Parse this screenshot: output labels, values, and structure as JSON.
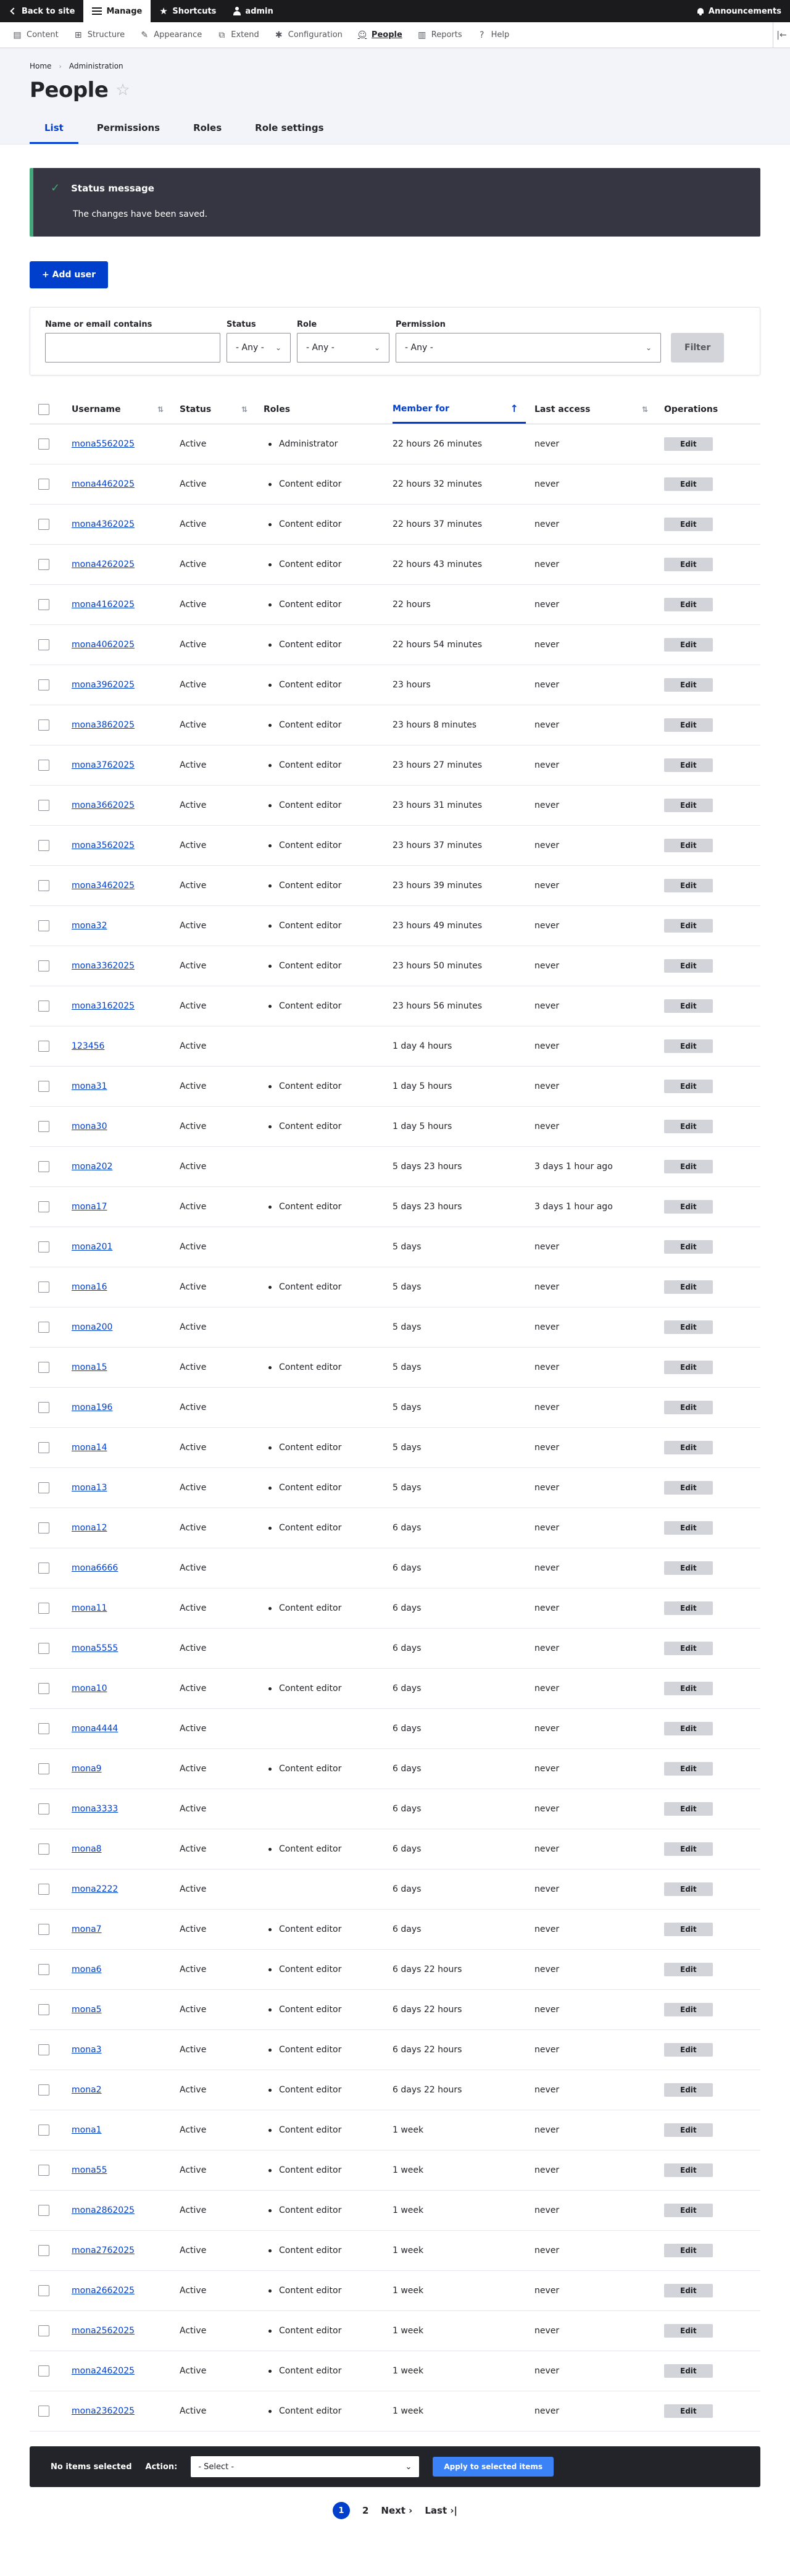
{
  "toolbar": {
    "back": "Back to site",
    "manage": "Manage",
    "shortcuts": "Shortcuts",
    "user": "admin",
    "announcements": "Announcements"
  },
  "admin_menu": [
    {
      "label": "Content",
      "icon": "content-icon"
    },
    {
      "label": "Structure",
      "icon": "structure-icon"
    },
    {
      "label": "Appearance",
      "icon": "appearance-icon"
    },
    {
      "label": "Extend",
      "icon": "extend-icon"
    },
    {
      "label": "Configuration",
      "icon": "configuration-icon"
    },
    {
      "label": "People",
      "icon": "people-icon"
    },
    {
      "label": "Reports",
      "icon": "reports-icon"
    },
    {
      "label": "Help",
      "icon": "help-icon"
    }
  ],
  "breadcrumb": [
    "Home",
    "Administration"
  ],
  "page_title": "People",
  "tabs": [
    "List",
    "Permissions",
    "Roles",
    "Role settings"
  ],
  "status": {
    "title": "Status message",
    "text": "The changes have been saved."
  },
  "add_user": "+ Add user",
  "filter": {
    "name_label": "Name or email contains",
    "status_label": "Status",
    "status_value": "- Any -",
    "role_label": "Role",
    "role_value": "- Any -",
    "permission_label": "Permission",
    "permission_value": "- Any -",
    "button": "Filter"
  },
  "table": {
    "headers": [
      "Username",
      "Status",
      "Roles",
      "Member for",
      "Last access",
      "Operations"
    ],
    "edit_label": "Edit",
    "rows": [
      {
        "username": "mona5562025",
        "status": "Active",
        "role": "Administrator",
        "member_for": "22 hours 26 minutes",
        "last_access": "never"
      },
      {
        "username": "mona4462025",
        "status": "Active",
        "role": "Content editor",
        "member_for": "22 hours 32 minutes",
        "last_access": "never"
      },
      {
        "username": "mona4362025",
        "status": "Active",
        "role": "Content editor",
        "member_for": "22 hours 37 minutes",
        "last_access": "never"
      },
      {
        "username": "mona4262025",
        "status": "Active",
        "role": "Content editor",
        "member_for": "22 hours 43 minutes",
        "last_access": "never"
      },
      {
        "username": "mona4162025",
        "status": "Active",
        "role": "Content editor",
        "member_for": "22 hours",
        "last_access": "never"
      },
      {
        "username": "mona4062025",
        "status": "Active",
        "role": "Content editor",
        "member_for": "22 hours 54 minutes",
        "last_access": "never"
      },
      {
        "username": "mona3962025",
        "status": "Active",
        "role": "Content editor",
        "member_for": "23 hours",
        "last_access": "never"
      },
      {
        "username": "mona3862025",
        "status": "Active",
        "role": "Content editor",
        "member_for": "23 hours 8 minutes",
        "last_access": "never"
      },
      {
        "username": "mona3762025",
        "status": "Active",
        "role": "Content editor",
        "member_for": "23 hours 27 minutes",
        "last_access": "never"
      },
      {
        "username": "mona3662025",
        "status": "Active",
        "role": "Content editor",
        "member_for": "23 hours 31 minutes",
        "last_access": "never"
      },
      {
        "username": "mona3562025",
        "status": "Active",
        "role": "Content editor",
        "member_for": "23 hours 37 minutes",
        "last_access": "never"
      },
      {
        "username": "mona3462025",
        "status": "Active",
        "role": "Content editor",
        "member_for": "23 hours 39 minutes",
        "last_access": "never"
      },
      {
        "username": "mona32",
        "status": "Active",
        "role": "Content editor",
        "member_for": "23 hours 49 minutes",
        "last_access": "never"
      },
      {
        "username": "mona3362025",
        "status": "Active",
        "role": "Content editor",
        "member_for": "23 hours 50 minutes",
        "last_access": "never"
      },
      {
        "username": "mona3162025",
        "status": "Active",
        "role": "Content editor",
        "member_for": "23 hours 56 minutes",
        "last_access": "never"
      },
      {
        "username": "123456",
        "status": "Active",
        "role": "",
        "member_for": "1 day 4 hours",
        "last_access": "never"
      },
      {
        "username": "mona31",
        "status": "Active",
        "role": "Content editor",
        "member_for": "1 day 5 hours",
        "last_access": "never"
      },
      {
        "username": "mona30",
        "status": "Active",
        "role": "Content editor",
        "member_for": "1 day 5 hours",
        "last_access": "never"
      },
      {
        "username": "mona202",
        "status": "Active",
        "role": "",
        "member_for": "5 days 23 hours",
        "last_access": "3 days 1 hour ago"
      },
      {
        "username": "mona17",
        "status": "Active",
        "role": "Content editor",
        "member_for": "5 days 23 hours",
        "last_access": "3 days 1 hour ago"
      },
      {
        "username": "mona201",
        "status": "Active",
        "role": "",
        "member_for": "5 days",
        "last_access": "never"
      },
      {
        "username": "mona16",
        "status": "Active",
        "role": "Content editor",
        "member_for": "5 days",
        "last_access": "never"
      },
      {
        "username": "mona200",
        "status": "Active",
        "role": "",
        "member_for": "5 days",
        "last_access": "never"
      },
      {
        "username": "mona15",
        "status": "Active",
        "role": "Content editor",
        "member_for": "5 days",
        "last_access": "never"
      },
      {
        "username": "mona196",
        "status": "Active",
        "role": "",
        "member_for": "5 days",
        "last_access": "never"
      },
      {
        "username": "mona14",
        "status": "Active",
        "role": "Content editor",
        "member_for": "5 days",
        "last_access": "never"
      },
      {
        "username": "mona13",
        "status": "Active",
        "role": "Content editor",
        "member_for": "5 days",
        "last_access": "never"
      },
      {
        "username": "mona12",
        "status": "Active",
        "role": "Content editor",
        "member_for": "6 days",
        "last_access": "never"
      },
      {
        "username": "mona6666",
        "status": "Active",
        "role": "",
        "member_for": "6 days",
        "last_access": "never"
      },
      {
        "username": "mona11",
        "status": "Active",
        "role": "Content editor",
        "member_for": "6 days",
        "last_access": "never"
      },
      {
        "username": "mona5555",
        "status": "Active",
        "role": "",
        "member_for": "6 days",
        "last_access": "never"
      },
      {
        "username": "mona10",
        "status": "Active",
        "role": "Content editor",
        "member_for": "6 days",
        "last_access": "never"
      },
      {
        "username": "mona4444",
        "status": "Active",
        "role": "",
        "member_for": "6 days",
        "last_access": "never"
      },
      {
        "username": "mona9",
        "status": "Active",
        "role": "Content editor",
        "member_for": "6 days",
        "last_access": "never"
      },
      {
        "username": "mona3333",
        "status": "Active",
        "role": "",
        "member_for": "6 days",
        "last_access": "never"
      },
      {
        "username": "mona8",
        "status": "Active",
        "role": "Content editor",
        "member_for": "6 days",
        "last_access": "never"
      },
      {
        "username": "mona2222",
        "status": "Active",
        "role": "",
        "member_for": "6 days",
        "last_access": "never"
      },
      {
        "username": "mona7",
        "status": "Active",
        "role": "Content editor",
        "member_for": "6 days",
        "last_access": "never"
      },
      {
        "username": "mona6",
        "status": "Active",
        "role": "Content editor",
        "member_for": "6 days 22 hours",
        "last_access": "never"
      },
      {
        "username": "mona5",
        "status": "Active",
        "role": "Content editor",
        "member_for": "6 days 22 hours",
        "last_access": "never"
      },
      {
        "username": "mona3",
        "status": "Active",
        "role": "Content editor",
        "member_for": "6 days 22 hours",
        "last_access": "never"
      },
      {
        "username": "mona2",
        "status": "Active",
        "role": "Content editor",
        "member_for": "6 days 22 hours",
        "last_access": "never"
      },
      {
        "username": "mona1",
        "status": "Active",
        "role": "Content editor",
        "member_for": "1 week",
        "last_access": "never"
      },
      {
        "username": "mona55",
        "status": "Active",
        "role": "Content editor",
        "member_for": "1 week",
        "last_access": "never"
      },
      {
        "username": "mona2862025",
        "status": "Active",
        "role": "Content editor",
        "member_for": "1 week",
        "last_access": "never"
      },
      {
        "username": "mona2762025",
        "status": "Active",
        "role": "Content editor",
        "member_for": "1 week",
        "last_access": "never"
      },
      {
        "username": "mona2662025",
        "status": "Active",
        "role": "Content editor",
        "member_for": "1 week",
        "last_access": "never"
      },
      {
        "username": "mona2562025",
        "status": "Active",
        "role": "Content editor",
        "member_for": "1 week",
        "last_access": "never"
      },
      {
        "username": "mona2462025",
        "status": "Active",
        "role": "Content editor",
        "member_for": "1 week",
        "last_access": "never"
      },
      {
        "username": "mona2362025",
        "status": "Active",
        "role": "Content editor",
        "member_for": "1 week",
        "last_access": "never"
      }
    ]
  },
  "bulk": {
    "selected": "No items selected",
    "action_label": "Action:",
    "action_value": "- Select -",
    "apply": "Apply to selected items"
  },
  "pager": {
    "current": "1",
    "page2": "2",
    "next": "Next ›",
    "last": "Last ›|"
  },
  "colors": {
    "accent": "#003ecc",
    "status_border": "#42a877",
    "status_bg": "#353641",
    "toolbar_bg": "#1b1b1d"
  }
}
